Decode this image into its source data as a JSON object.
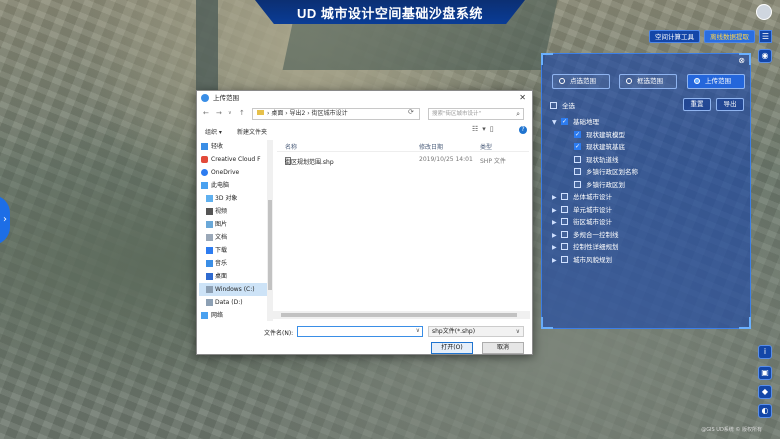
{
  "app": {
    "title": "UD 城市设计空间基础沙盘系统",
    "top_buttons": [
      "空间计算工具",
      "离线数据提取"
    ],
    "copyright": "@GIS UD系统 © 版权所有"
  },
  "panel": {
    "radios": [
      {
        "label": "点选范围",
        "active": false
      },
      {
        "label": "框选范围",
        "active": false
      },
      {
        "label": "上传范围",
        "active": true
      }
    ],
    "select_all": "全选",
    "reset": "重置",
    "export": "导出",
    "tree": [
      {
        "label": "基础地理",
        "checked": true,
        "expanded": true,
        "level": 0
      },
      {
        "label": "现状建筑模型",
        "checked": true,
        "level": 1
      },
      {
        "label": "现状建筑基底",
        "checked": true,
        "level": 1
      },
      {
        "label": "现状轨道线",
        "checked": false,
        "level": 1
      },
      {
        "label": "乡镇行政区划名称",
        "checked": false,
        "level": 1
      },
      {
        "label": "乡镇行政区划",
        "checked": false,
        "level": 1
      },
      {
        "label": "总体城市设计",
        "checked": false,
        "level": 0
      },
      {
        "label": "单元城市设计",
        "checked": false,
        "level": 0
      },
      {
        "label": "街区城市设计",
        "checked": false,
        "level": 0
      },
      {
        "label": "多规合一控制线",
        "checked": false,
        "level": 0
      },
      {
        "label": "控制性详细规划",
        "checked": false,
        "level": 0
      },
      {
        "label": "城市风貌规划",
        "checked": false,
        "level": 0
      }
    ]
  },
  "dialog": {
    "title": "上传范围",
    "address": [
      "桌面",
      "导出2",
      "街区城市设计"
    ],
    "search_placeholder": "搜索\"街区城市设计\"",
    "organize": "组织 ▾",
    "new_folder": "新建文件夹",
    "nav": [
      {
        "label": "轻收",
        "icon": "pin-icon"
      },
      {
        "label": "Creative Cloud F",
        "icon": "cloud-icon"
      },
      {
        "label": "OneDrive",
        "icon": "onedrive-icon"
      },
      {
        "label": "此电脑",
        "icon": "pc-icon"
      },
      {
        "label": "3D 对象",
        "icon": "cube-icon"
      },
      {
        "label": "视频",
        "icon": "video-icon"
      },
      {
        "label": "图片",
        "icon": "picture-icon"
      },
      {
        "label": "文档",
        "icon": "document-icon"
      },
      {
        "label": "下载",
        "icon": "download-icon"
      },
      {
        "label": "音乐",
        "icon": "music-icon"
      },
      {
        "label": "桌面",
        "icon": "desktop-icon"
      },
      {
        "label": "Windows (C:)",
        "icon": "drive-icon"
      },
      {
        "label": "Data (D:)",
        "icon": "drive-icon"
      },
      {
        "label": "网络",
        "icon": "network-icon"
      }
    ],
    "columns": [
      "名称",
      "修改日期",
      "类型"
    ],
    "file": {
      "name": "街区规划范围.shp",
      "date": "2019/10/25 14:01",
      "type": "SHP 文件"
    },
    "filename_label": "文件名(N):",
    "filename_value": "",
    "filetype": "shp文件(*.shp)",
    "open": "打开(O)",
    "cancel": "取消"
  }
}
